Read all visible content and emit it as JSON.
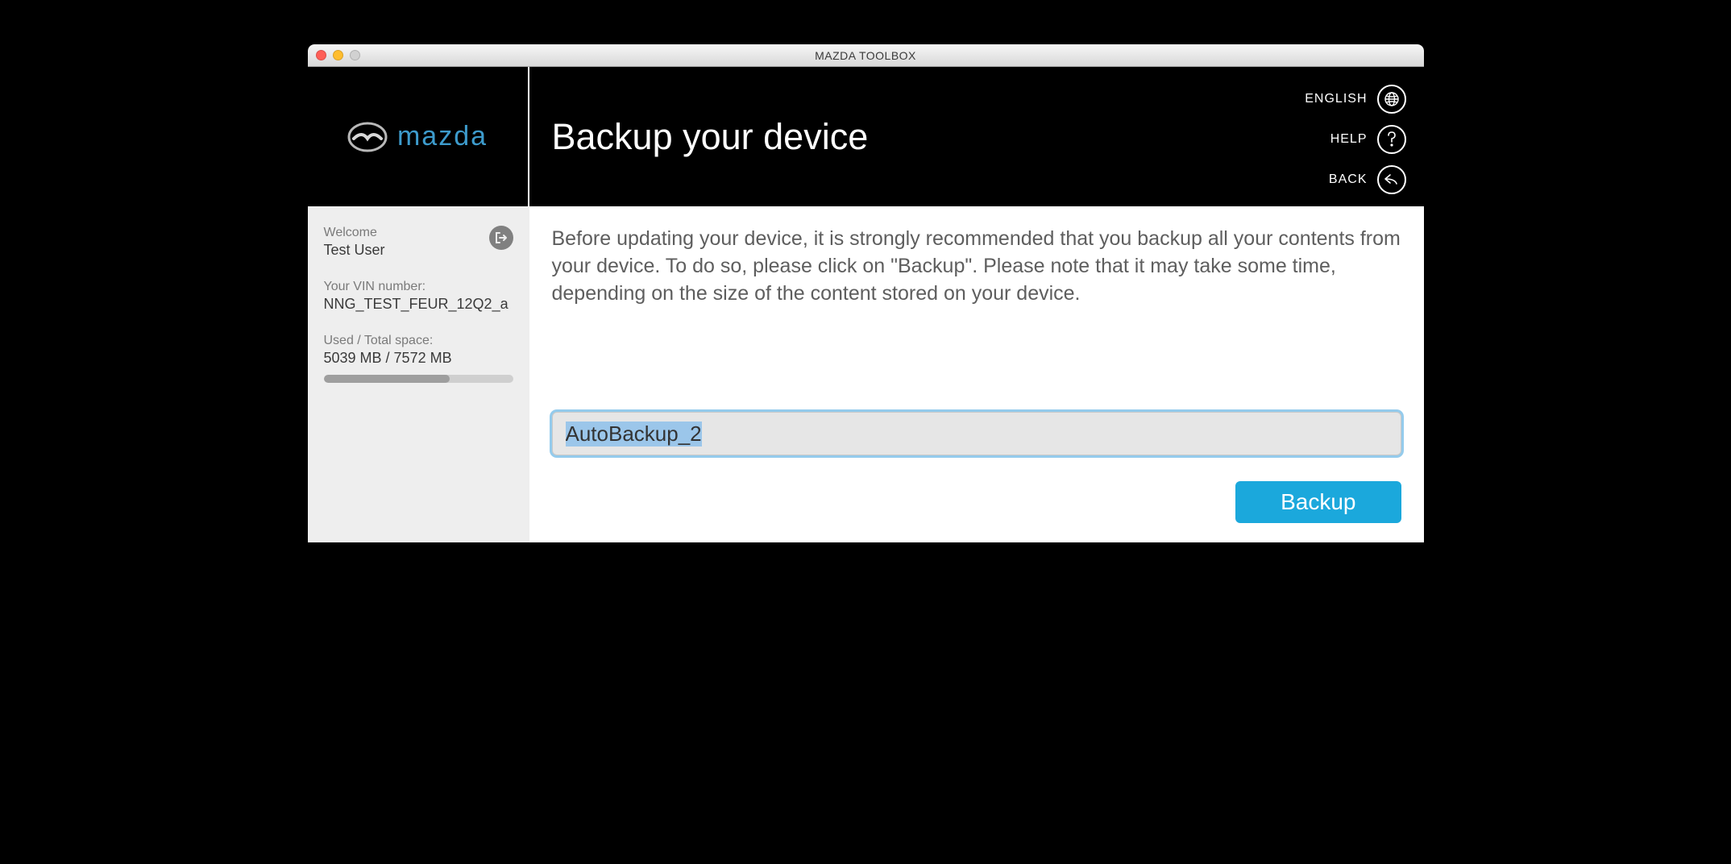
{
  "window": {
    "title": "MAZDA TOOLBOX"
  },
  "logo": {
    "brand": "mazda"
  },
  "header": {
    "page_title": "Backup your device",
    "actions": {
      "language_label": "ENGLISH",
      "help_label": "HELP",
      "back_label": "BACK"
    }
  },
  "sidebar": {
    "welcome_label": "Welcome",
    "username": "Test User",
    "vin_label": "Your VIN number:",
    "vin_value": "NNG_TEST_FEUR_12Q2_a",
    "space_label": "Used / Total space:",
    "space_value": "5039 MB / 7572 MB",
    "storage_used_mb": 5039,
    "storage_total_mb": 7572
  },
  "content": {
    "instructions": "Before updating your device, it is strongly recommended that you backup all your contents from your device. To do so, please click on \"Backup\". Please note that it may take some time, depending on the size of the content stored on your device.",
    "backup_name_value": "AutoBackup_2",
    "backup_button": "Backup"
  }
}
